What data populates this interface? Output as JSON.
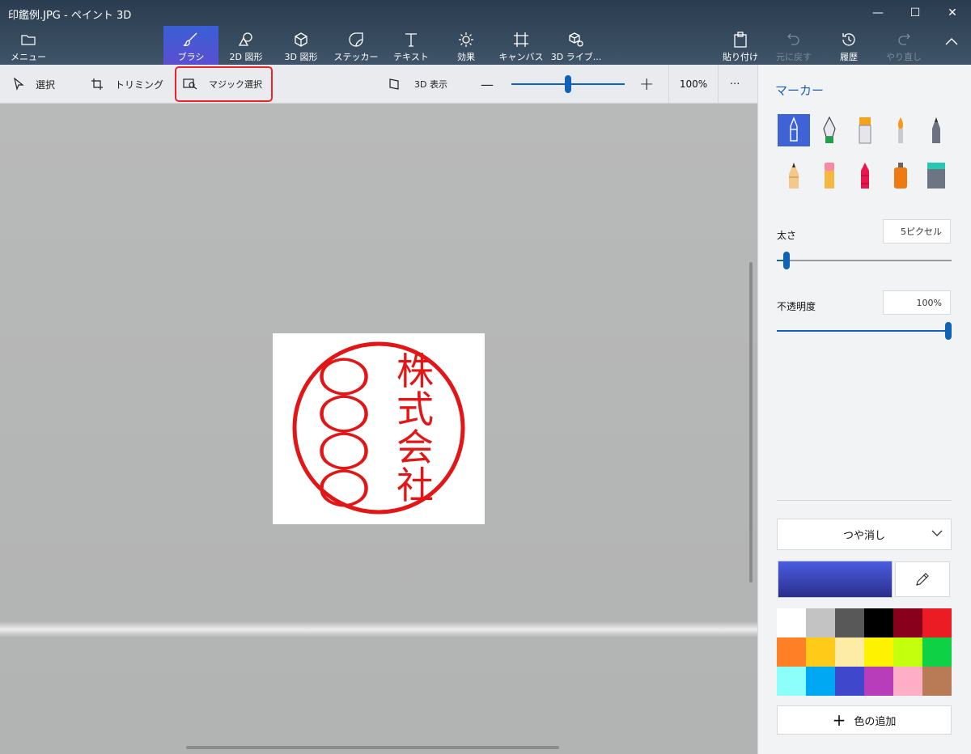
{
  "window": {
    "title": "印鑑例.JPG - ペイント 3D",
    "minimize_icon": "—",
    "maximize_icon": "☐",
    "close_icon": "✕"
  },
  "ribbon": {
    "menu_label": "メニュー",
    "tabs": [
      {
        "label": "ブラシ",
        "icon": "brush-icon",
        "active": true
      },
      {
        "label": "2D 図形",
        "icon": "2d-shapes-icon"
      },
      {
        "label": "3D 図形",
        "icon": "3d-shapes-icon"
      },
      {
        "label": "ステッカー",
        "icon": "sticker-icon"
      },
      {
        "label": "テキスト",
        "icon": "text-icon"
      },
      {
        "label": "効果",
        "icon": "effects-icon"
      },
      {
        "label": "キャンバス",
        "icon": "canvas-icon"
      },
      {
        "label": "3D ライブ...",
        "icon": "3d-library-icon"
      }
    ],
    "actions": {
      "paste": "貼り付け",
      "undo": "元に戻す",
      "history": "履歴",
      "redo": "やり直し"
    }
  },
  "toolbar": {
    "select": "選択",
    "crop": "トリミング",
    "magic_select": "マジック選択",
    "view_3d": "3D 表示",
    "zoom_out": "—",
    "zoom_in": "+",
    "zoom_level": 100,
    "zoom_text": "100%",
    "more": "···"
  },
  "canvas": {
    "stamp_left_column": [
      "○",
      "○",
      "○",
      "○"
    ],
    "stamp_right_column": [
      "株",
      "式",
      "会",
      "社"
    ],
    "stamp_color": "#e21616"
  },
  "panel": {
    "title": "マーカー",
    "brushes": [
      "marker",
      "calligraphy-pen",
      "oil-brush",
      "watercolor",
      "pixel-pen",
      "pencil",
      "eraser",
      "crayon",
      "spray-can",
      "fill-bucket"
    ],
    "selected_brush": "marker",
    "thickness_label": "太さ",
    "thickness_value": "5ピクセル",
    "thickness_fraction": 0.05,
    "opacity_label": "不透明度",
    "opacity_value": "100%",
    "opacity_fraction": 1.0,
    "finish": "つや消し",
    "current_color": "#3d4bc8",
    "palette": [
      "#ffffff",
      "#c3c3c3",
      "#585858",
      "#000000",
      "#88001b",
      "#ec1c24",
      "#ff7f27",
      "#ffca18",
      "#fdeca6",
      "#fff200",
      "#c4ff0e",
      "#0ed145",
      "#8cfffb",
      "#00a8f3",
      "#3f48cc",
      "#b83dba",
      "#ffaec8",
      "#b97a56"
    ],
    "add_color": "色の追加"
  }
}
